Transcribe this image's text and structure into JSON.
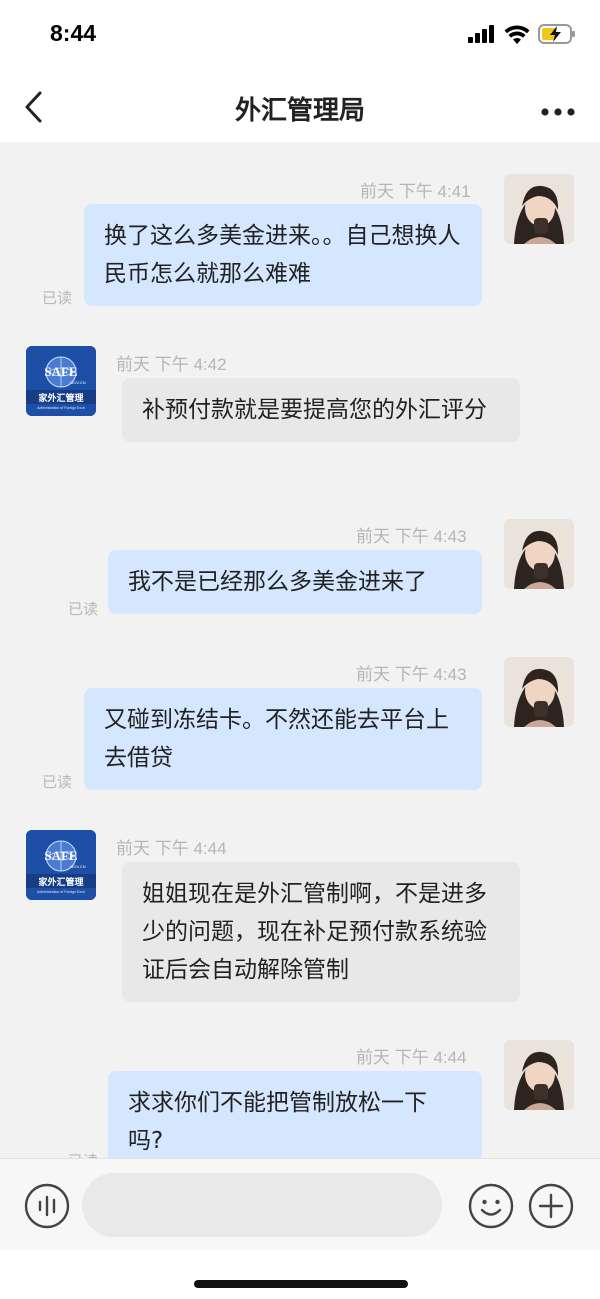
{
  "status": {
    "time": "8:44"
  },
  "nav": {
    "title": "外汇管理局"
  },
  "logo": {
    "text": "SAFE",
    "domain": "GOV.CN",
    "org": "家外汇管理",
    "org_en": "Administration of Foreign Exch"
  },
  "messages": [
    {
      "from": "user",
      "timestamp": "前天 下午 4:41",
      "text": "换了这么多美金进来。。自己想换人民币怎么就那么难难",
      "read": "已读"
    },
    {
      "from": "safe",
      "timestamp": "前天 下午 4:42",
      "text": "补预付款就是要提高您的外汇评分"
    },
    {
      "from": "user",
      "timestamp": "前天 下午 4:43",
      "text": "我不是已经那么多美金进来了",
      "read": "已读"
    },
    {
      "from": "user",
      "timestamp": "前天 下午 4:43",
      "text": "又碰到冻结卡。不然还能去平台上去借贷",
      "read": "已读"
    },
    {
      "from": "safe",
      "timestamp": "前天 下午 4:44",
      "text": "姐姐现在是外汇管制啊，不是进多少的问题，现在补足预付款系统验证后会自动解除管制"
    },
    {
      "from": "user",
      "timestamp": "前天 下午 4:44",
      "text": "求求你们不能把管制放松一下吗?",
      "read": "已读"
    }
  ],
  "input": {
    "placeholder": "",
    "value": ""
  },
  "icons": {
    "back": "chevron-left-icon",
    "more": "more-dots-icon",
    "voice": "voice-icon",
    "emoji": "emoji-icon",
    "plus": "plus-icon"
  },
  "colors": {
    "user_bubble": "#d5e6ff",
    "safe_bubble": "#e8e8e8",
    "background": "#f2f2f2"
  }
}
